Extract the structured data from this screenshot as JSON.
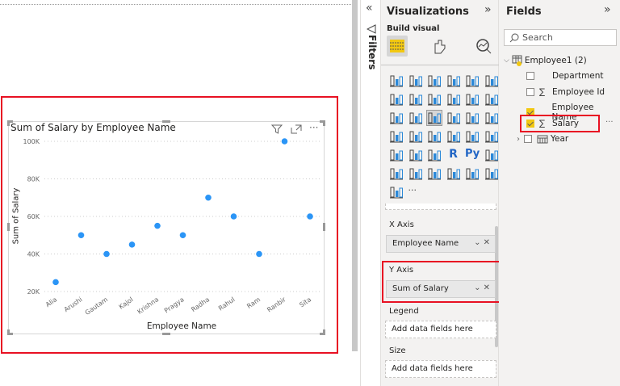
{
  "chart_data": {
    "type": "scatter",
    "title": "Sum of Salary by Employee Name",
    "xlabel": "Employee Name",
    "ylabel": "Sum of Salary",
    "categories": [
      "Alia",
      "Arushi",
      "Gautam",
      "Kajol",
      "Krishna",
      "Pragya",
      "Radha",
      "Rahul",
      "Ram",
      "Ranbir",
      "Sita"
    ],
    "values": [
      25000,
      50000,
      40000,
      45000,
      55000,
      50000,
      70000,
      60000,
      40000,
      100000,
      60000
    ],
    "ylim": [
      20000,
      100000
    ],
    "yticks": [
      20000,
      40000,
      60000,
      80000,
      100000
    ],
    "ytick_labels": [
      "20K",
      "40K",
      "60K",
      "80K",
      "100K"
    ],
    "grid": true,
    "marker_color": "#2b95f6",
    "highlight_color": "#e81123"
  },
  "filters": {
    "label": "Filters"
  },
  "viz": {
    "title": "Visualizations",
    "build_visual": "Build visual",
    "gallery_icons": [
      "stacked-bar-icon",
      "stacked-column-icon",
      "clustered-bar-icon",
      "clustered-column-icon",
      "100-stacked-bar-icon",
      "100-stacked-column-icon",
      "line-chart-icon",
      "area-chart-icon",
      "stacked-area-icon",
      "line-column-icon",
      "line-clustered-column-icon",
      "ribbon-chart-icon",
      "waterfall-icon",
      "funnel-icon",
      "scatter-chart-icon",
      "pie-chart-icon",
      "donut-chart-icon",
      "treemap-icon",
      "map-icon",
      "filled-map-icon",
      "gauge-icon",
      "card-icon",
      "multi-row-card-icon",
      "kpi-icon",
      "slicer-icon",
      "table-icon",
      "matrix-icon",
      "r-visual-icon",
      "python-visual-icon",
      "key-influencers-icon",
      "decomposition-tree-icon",
      "qa-icon",
      "smart-narrative-icon",
      "paginated-report-icon",
      "power-apps-icon",
      "power-automate-icon",
      "more-visuals-icon",
      "more-options-icon"
    ],
    "x_axis_label": "X Axis",
    "x_axis_value": "Employee Name",
    "y_axis_label": "Y Axis",
    "y_axis_value": "Sum of Salary",
    "legend_label": "Legend",
    "legend_placeholder": "Add data fields here",
    "size_label": "Size",
    "size_placeholder": "Add data fields here"
  },
  "fields": {
    "title": "Fields",
    "search_placeholder": "Search",
    "table_name": "Employee1 (2)",
    "items": [
      {
        "label": "Department",
        "checked": false,
        "sigma": false
      },
      {
        "label": "Employee Id",
        "checked": false,
        "sigma": true
      },
      {
        "label": "Employee Name",
        "checked": true,
        "sigma": false
      },
      {
        "label": "Salary",
        "checked": true,
        "sigma": true
      },
      {
        "label": "Year",
        "checked": false,
        "sigma": false
      }
    ],
    "sigma": "∑",
    "more": "···"
  }
}
